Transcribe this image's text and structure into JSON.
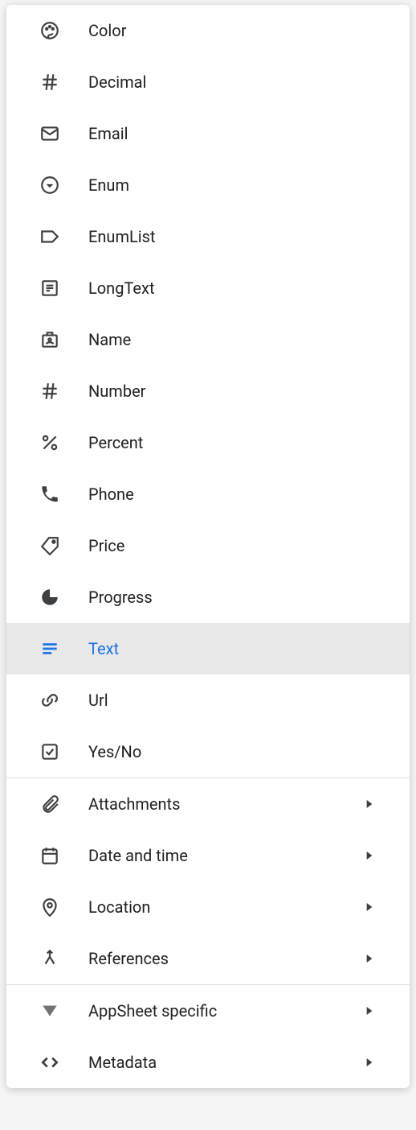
{
  "colors": {
    "selected": "#1a73e8",
    "text": "#202124",
    "icon": "#3c4043",
    "divider": "#dadce0",
    "selectedBg": "#e8e8e8"
  },
  "items": {
    "color": {
      "label": "Color"
    },
    "decimal": {
      "label": "Decimal"
    },
    "email": {
      "label": "Email"
    },
    "enum": {
      "label": "Enum"
    },
    "enumlist": {
      "label": "EnumList"
    },
    "longtext": {
      "label": "LongText"
    },
    "name": {
      "label": "Name"
    },
    "number": {
      "label": "Number"
    },
    "percent": {
      "label": "Percent"
    },
    "phone": {
      "label": "Phone"
    },
    "price": {
      "label": "Price"
    },
    "progress": {
      "label": "Progress"
    },
    "text": {
      "label": "Text"
    },
    "url": {
      "label": "Url"
    },
    "yesno": {
      "label": "Yes/No"
    }
  },
  "groups": {
    "attachments": {
      "label": "Attachments"
    },
    "datetime": {
      "label": "Date and time"
    },
    "location": {
      "label": "Location"
    },
    "references": {
      "label": "References"
    },
    "appsheet": {
      "label": "AppSheet specific"
    },
    "metadata": {
      "label": "Metadata"
    }
  },
  "selected": "text"
}
